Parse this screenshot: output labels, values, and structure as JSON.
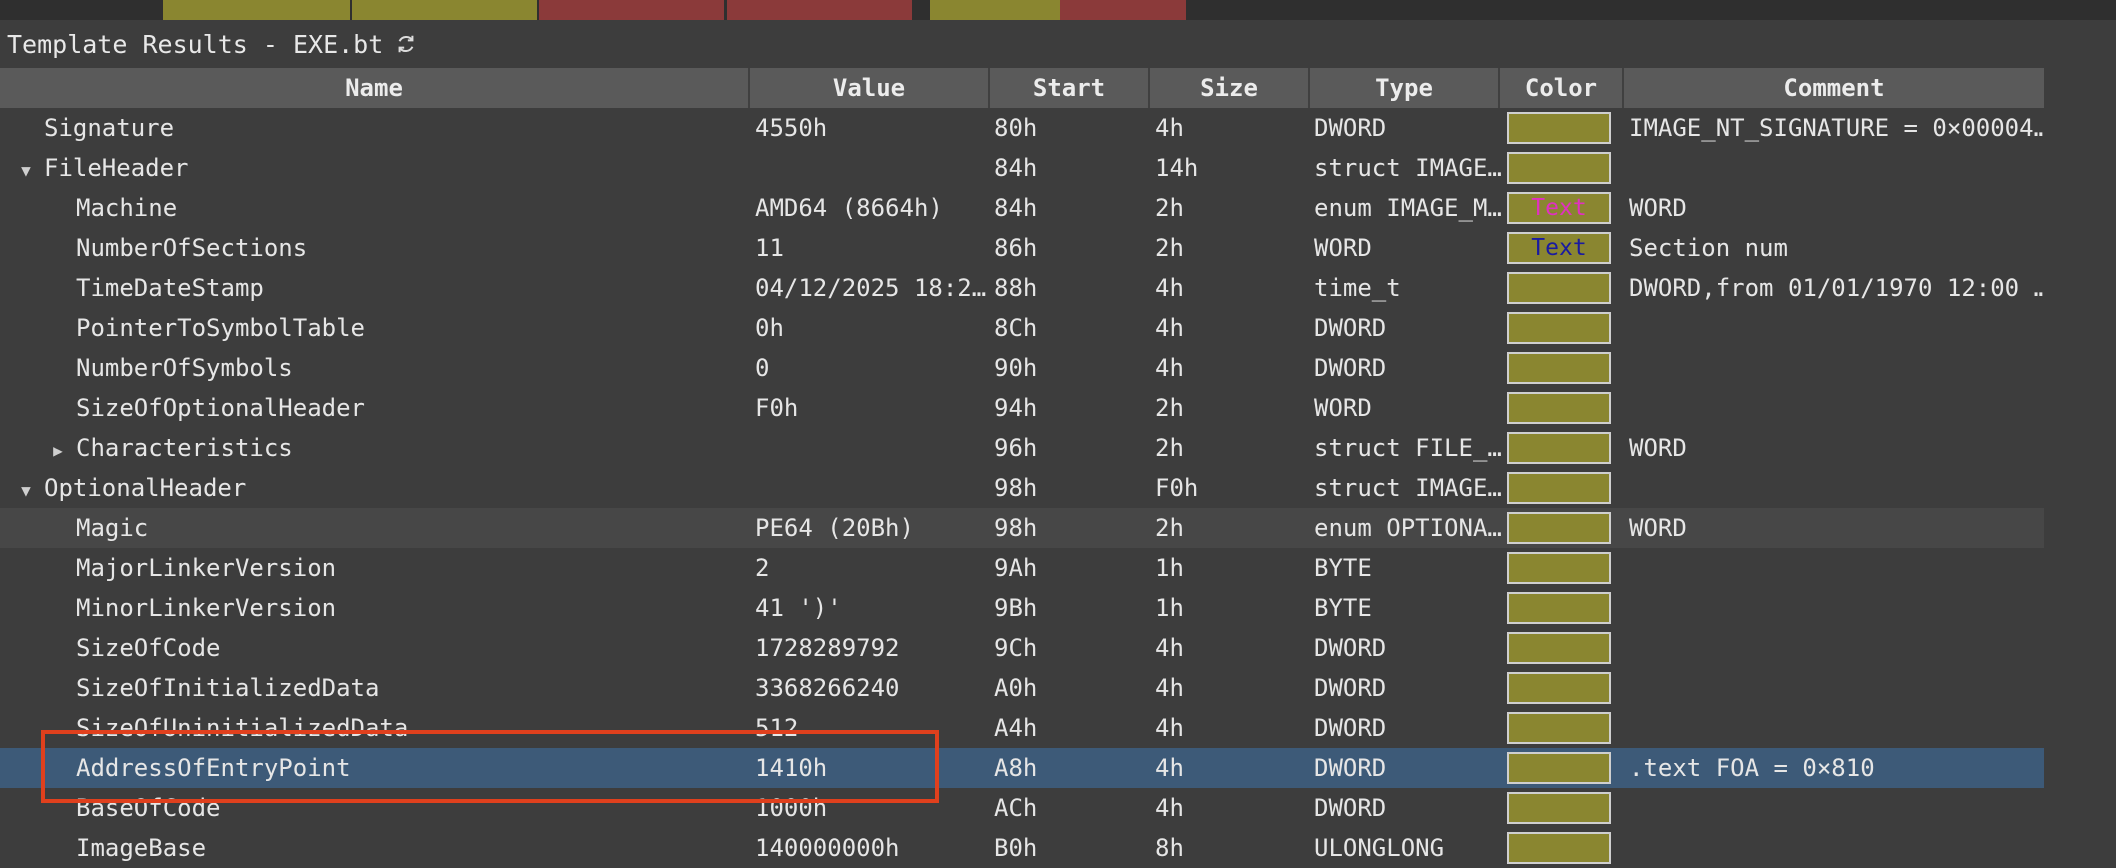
{
  "window": {
    "title": "Template Results - EXE.bt",
    "refresh_icon": "refresh-icon"
  },
  "columns": [
    "Name",
    "Value",
    "Start",
    "Size",
    "Type",
    "Color",
    "Comment"
  ],
  "rows": [
    {
      "name": "Signature",
      "depth": 1,
      "expander": "",
      "value": "4550h",
      "start": "80h",
      "size": "4h",
      "type": "DWORD",
      "color_text": "",
      "color_fg": "",
      "comment": "IMAGE_NT_SIGNATURE = 0×00004…"
    },
    {
      "name": "FileHeader",
      "depth": 1,
      "expander": "down",
      "value": "",
      "start": "84h",
      "size": "14h",
      "type": "struct IMAGE…",
      "color_text": "",
      "color_fg": "",
      "comment": ""
    },
    {
      "name": "Machine",
      "depth": 2,
      "expander": "",
      "value": "AMD64 (8664h)",
      "start": "84h",
      "size": "2h",
      "type": "enum IMAGE_M…",
      "color_text": "Text",
      "color_fg": "#e030c0",
      "comment": "WORD"
    },
    {
      "name": "NumberOfSections",
      "depth": 2,
      "expander": "",
      "value": "11",
      "start": "86h",
      "size": "2h",
      "type": "WORD",
      "color_text": "Text",
      "color_fg": "#1a1aa0",
      "comment": "Section num"
    },
    {
      "name": "TimeDateStamp",
      "depth": 2,
      "expander": "",
      "value": "04/12/2025 18:2…",
      "start": "88h",
      "size": "4h",
      "type": "time_t",
      "color_text": "",
      "color_fg": "",
      "comment": "DWORD,from 01/01/1970 12:00 …"
    },
    {
      "name": "PointerToSymbolTable",
      "depth": 2,
      "expander": "",
      "value": "0h",
      "start": "8Ch",
      "size": "4h",
      "type": "DWORD",
      "color_text": "",
      "color_fg": "",
      "comment": ""
    },
    {
      "name": "NumberOfSymbols",
      "depth": 2,
      "expander": "",
      "value": "0",
      "start": "90h",
      "size": "4h",
      "type": "DWORD",
      "color_text": "",
      "color_fg": "",
      "comment": ""
    },
    {
      "name": "SizeOfOptionalHeader",
      "depth": 2,
      "expander": "",
      "value": "F0h",
      "start": "94h",
      "size": "2h",
      "type": "WORD",
      "color_text": "",
      "color_fg": "",
      "comment": ""
    },
    {
      "name": "Characteristics",
      "depth": 2,
      "expander": "right",
      "value": "",
      "start": "96h",
      "size": "2h",
      "type": "struct FILE_…",
      "color_text": "",
      "color_fg": "",
      "comment": "WORD"
    },
    {
      "name": "OptionalHeader",
      "depth": 1,
      "expander": "down",
      "value": "",
      "start": "98h",
      "size": "F0h",
      "type": "struct IMAGE…",
      "color_text": "",
      "color_fg": "",
      "comment": ""
    },
    {
      "name": "Magic",
      "depth": 2,
      "expander": "",
      "value": "PE64 (20Bh)",
      "start": "98h",
      "size": "2h",
      "type": "enum OPTIONA…",
      "color_text": "",
      "color_fg": "",
      "comment": "WORD",
      "alt": true
    },
    {
      "name": "MajorLinkerVersion",
      "depth": 2,
      "expander": "",
      "value": "2",
      "start": "9Ah",
      "size": "1h",
      "type": "BYTE",
      "color_text": "",
      "color_fg": "",
      "comment": ""
    },
    {
      "name": "MinorLinkerVersion",
      "depth": 2,
      "expander": "",
      "value": "41 ')'",
      "start": "9Bh",
      "size": "1h",
      "type": "BYTE",
      "color_text": "",
      "color_fg": "",
      "comment": ""
    },
    {
      "name": "SizeOfCode",
      "depth": 2,
      "expander": "",
      "value": "1728289792",
      "start": "9Ch",
      "size": "4h",
      "type": "DWORD",
      "color_text": "",
      "color_fg": "",
      "comment": ""
    },
    {
      "name": "SizeOfInitializedData",
      "depth": 2,
      "expander": "",
      "value": "3368266240",
      "start": "A0h",
      "size": "4h",
      "type": "DWORD",
      "color_text": "",
      "color_fg": "",
      "comment": ""
    },
    {
      "name": "SizeOfUninitializedData",
      "depth": 2,
      "expander": "",
      "value": "512",
      "start": "A4h",
      "size": "4h",
      "type": "DWORD",
      "color_text": "",
      "color_fg": "",
      "comment": ""
    },
    {
      "name": "AddressOfEntryPoint",
      "depth": 2,
      "expander": "",
      "value": "1410h",
      "start": "A8h",
      "size": "4h",
      "type": "DWORD",
      "color_text": "",
      "color_fg": "",
      "comment": ".text FOA = 0×810",
      "selected": true
    },
    {
      "name": "BaseOfCode",
      "depth": 2,
      "expander": "",
      "value": "1000h",
      "start": "ACh",
      "size": "4h",
      "type": "DWORD",
      "color_text": "",
      "color_fg": "",
      "comment": ""
    },
    {
      "name": "ImageBase",
      "depth": 2,
      "expander": "",
      "value": "140000000h",
      "start": "B0h",
      "size": "8h",
      "type": "ULONGLONG",
      "color_text": "",
      "color_fg": "",
      "comment": ""
    }
  ],
  "colors": {
    "swatch_bg": "#8a8630",
    "selected_row": "#3d5a78",
    "highlight_border": "#e0401d"
  }
}
